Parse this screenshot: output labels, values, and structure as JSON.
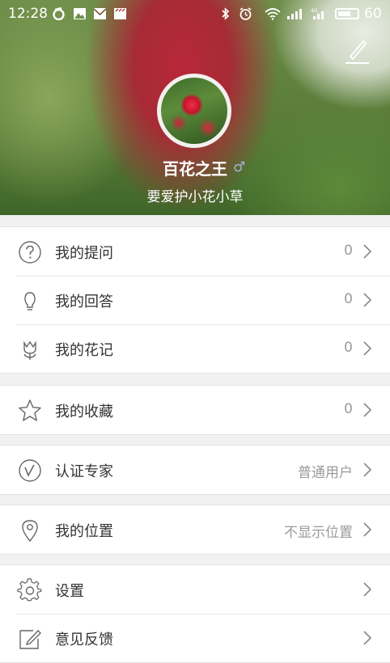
{
  "status_bar": {
    "time": "12:28",
    "battery": "60"
  },
  "profile": {
    "name": "百花之王",
    "gender_symbol": "♂",
    "motto": "要爱护小花小草"
  },
  "menu": {
    "questions": {
      "label": "我的提问",
      "value": "0"
    },
    "answers": {
      "label": "我的回答",
      "value": "0"
    },
    "notes": {
      "label": "我的花记",
      "value": "0"
    },
    "favorites": {
      "label": "我的收藏",
      "value": "0"
    },
    "expert": {
      "label": "认证专家",
      "value": "普通用户"
    },
    "location": {
      "label": "我的位置",
      "value": "不显示位置"
    },
    "settings": {
      "label": "设置"
    },
    "feedback": {
      "label": "意见反馈"
    }
  }
}
